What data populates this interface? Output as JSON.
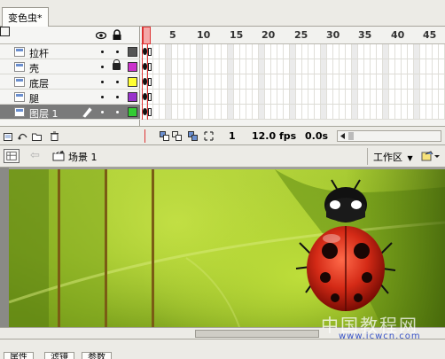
{
  "document": {
    "tab_label": "变色虫*"
  },
  "timeline": {
    "frame_numbers": [
      "1",
      "5",
      "10",
      "15",
      "20",
      "25",
      "30",
      "35",
      "40",
      "45"
    ],
    "layers": [
      {
        "name": "拉杆",
        "locked": false,
        "color": "#555555",
        "selected": false
      },
      {
        "name": "壳",
        "locked": true,
        "color": "#cc33cc",
        "selected": false
      },
      {
        "name": "底层",
        "locked": false,
        "color": "#ffff33",
        "selected": false
      },
      {
        "name": "腿",
        "locked": false,
        "color": "#9933cc",
        "selected": false
      },
      {
        "name": "图层 1",
        "locked": false,
        "color": "#33cc33",
        "selected": true
      }
    ],
    "current_frame": "1",
    "frame_rate": "12.0 fps",
    "elapsed_time": "0.0s"
  },
  "editbar": {
    "scene_label": "场景 1",
    "workspace_label": "工作区"
  },
  "bottom_tabs": [
    "属性",
    "滤镜",
    "参数"
  ],
  "watermark": {
    "text": "中国教程网",
    "url": "www.jcwcn.com"
  },
  "colors": {
    "leaf_light": "#c2df44",
    "leaf_dark": "#6e9515",
    "ladybug_red": "#d42a16",
    "guide_line": "#7a5c14",
    "playhead": "#dd3333"
  },
  "icons": {
    "show_hide": "eye-icon",
    "lock_all": "lock-icon",
    "outline": "outline-square-icon",
    "edit_pencil": "pencil-icon",
    "new_layer": "new-layer-icon",
    "add_guide": "add-motion-guide-icon",
    "new_folder": "new-folder-icon",
    "delete_layer": "trash-icon"
  }
}
